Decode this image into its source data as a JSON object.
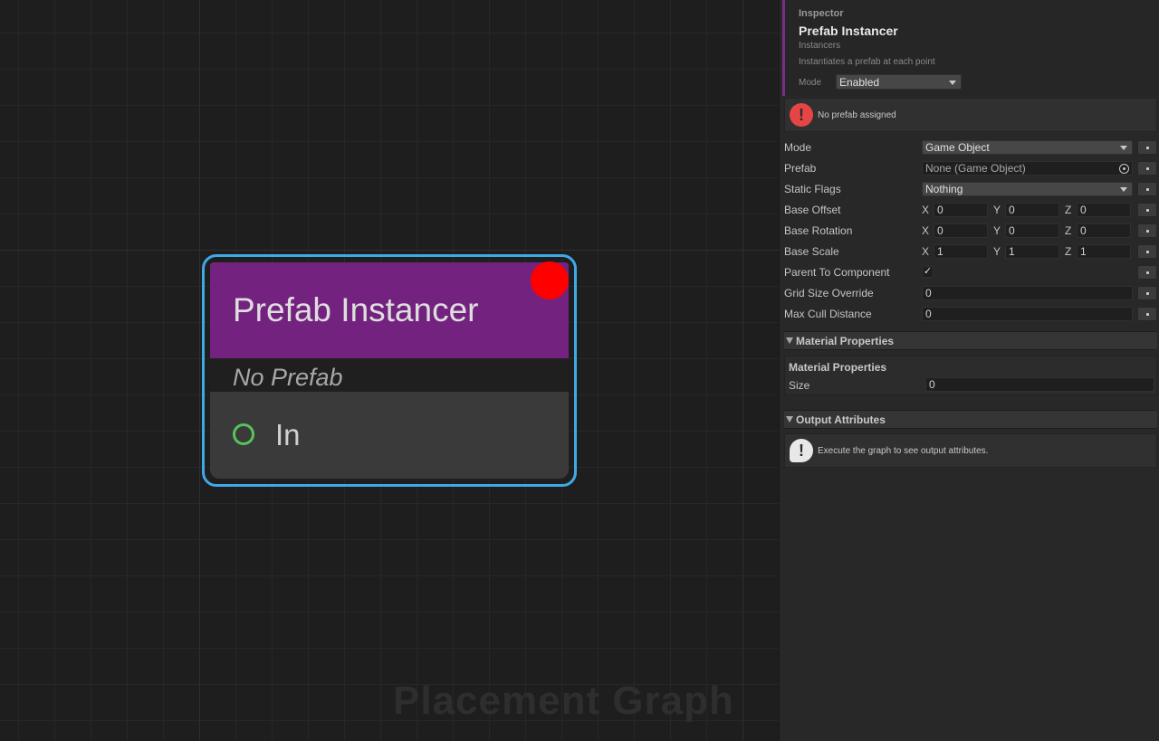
{
  "graph": {
    "watermark": "Placement Graph",
    "node": {
      "title": "Prefab Instancer",
      "subtitle": "No Prefab",
      "port_label": "In",
      "header_color": "#73237f",
      "selection_color": "#3fa9e8",
      "error_color": "#ff0000",
      "port_color": "#58c35a"
    }
  },
  "inspector": {
    "kind": "Inspector",
    "title": "Prefab Instancer",
    "category": "Instancers",
    "description": "Instantiates a prefab at each point",
    "mode_label": "Mode",
    "mode_value": "Enabled",
    "error_message": "No prefab assigned",
    "properties": {
      "mode": {
        "label": "Mode",
        "value": "Game Object"
      },
      "prefab": {
        "label": "Prefab",
        "value": "None (Game Object)"
      },
      "static_flags": {
        "label": "Static Flags",
        "value": "Nothing"
      },
      "base_offset": {
        "label": "Base Offset",
        "x": "0",
        "y": "0",
        "z": "0"
      },
      "base_rotation": {
        "label": "Base Rotation",
        "x": "0",
        "y": "0",
        "z": "0"
      },
      "base_scale": {
        "label": "Base Scale",
        "x": "1",
        "y": "1",
        "z": "1"
      },
      "parent_to_component": {
        "label": "Parent To Component",
        "checked": true,
        "check_glyph": "✓"
      },
      "grid_size_override": {
        "label": "Grid Size Override",
        "value": "0"
      },
      "max_cull_distance": {
        "label": "Max Cull Distance",
        "value": "0"
      }
    },
    "axis_labels": {
      "x": "X",
      "y": "Y",
      "z": "Z"
    },
    "material_section": {
      "foldout_label": "Material Properties",
      "box_title": "Material Properties",
      "size_label": "Size",
      "size_value": "0"
    },
    "output_section": {
      "foldout_label": "Output Attributes",
      "info_message": "Execute the graph to see output attributes."
    },
    "icons": {
      "error": "error-circle-icon",
      "info": "info-bubble-icon",
      "dropdown": "chevron-down-icon",
      "object_picker": "target-icon"
    },
    "colors": {
      "accent": "#7a2d8a",
      "error_icon": "#e54545",
      "info_icon": "#e8e8e8"
    }
  }
}
